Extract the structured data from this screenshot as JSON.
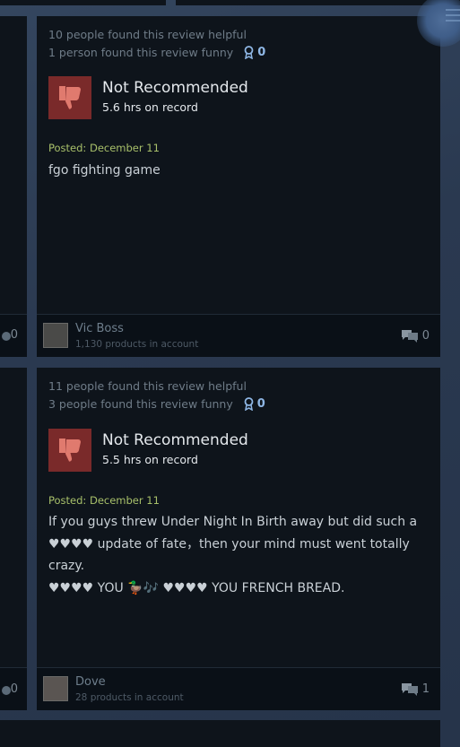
{
  "reviews": [
    {
      "helpful": "10 people found this review helpful",
      "funny": "1 person found this review funny",
      "awards": "0",
      "verdict": "Not Recommended",
      "hours": "5.6 hrs on record",
      "posted": "Posted: December 11",
      "body": [
        "fgo fighting game"
      ],
      "author": "Vic Boss",
      "products": "1,130 products in account",
      "comments": "0"
    },
    {
      "helpful": "11 people found this review helpful",
      "funny": "3 people found this review funny",
      "awards": "0",
      "verdict": "Not Recommended",
      "hours": "5.5 hrs on record",
      "posted": "Posted: December 11",
      "body": [
        "If you guys threw Under Night In Birth away but did such a",
        "♥♥♥♥ update of fate，then your mind must went totally",
        "crazy.",
        "♥♥♥♥ YOU 🦆🎶 ♥♥♥♥ YOU FRENCH BREAD."
      ],
      "author": "Dove",
      "products": "28 products in account",
      "comments": "1"
    }
  ],
  "left_column": {
    "counts": [
      "0",
      "0"
    ]
  },
  "icons": {
    "verdict_icon": "thumbs-down-icon",
    "award_icon": "award-ribbon-icon",
    "comment_icon": "comment-bubble-icon"
  },
  "colors": {
    "thumb_box": "#7a2a2a",
    "posted": "#a8c06a",
    "award": "#8fb7e5"
  }
}
